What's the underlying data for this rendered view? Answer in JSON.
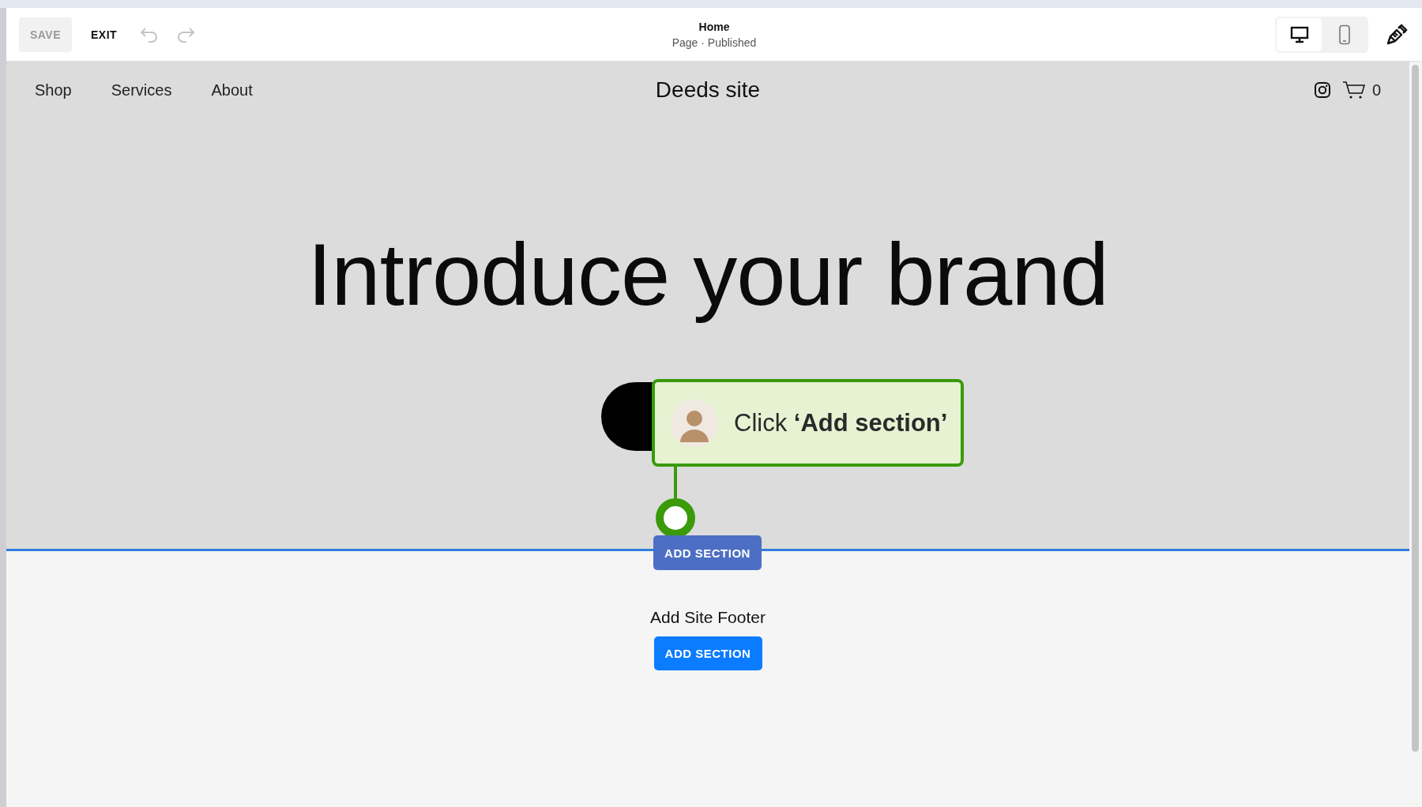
{
  "toolbar": {
    "save": {
      "label": "SAVE",
      "disabled": true
    },
    "exit": {
      "label": "EXIT"
    },
    "title": "Home",
    "subtitle": "Page · Published",
    "view_toggle": [
      {
        "kind": "desktop",
        "selected": true
      },
      {
        "kind": "mobile",
        "selected": false
      }
    ]
  },
  "site": {
    "nav": [
      {
        "label": "Shop"
      },
      {
        "label": "Services"
      },
      {
        "label": "About"
      }
    ],
    "site_title": "Deeds site",
    "cart_count": "0",
    "headline": "Introduce your brand"
  },
  "tooltip": {
    "text": "Click **‘Add section’**"
  },
  "section_button": {
    "label": "ADD SECTION"
  },
  "footer": {
    "heading": "Add Site Footer",
    "button": "ADD SECTION"
  }
}
